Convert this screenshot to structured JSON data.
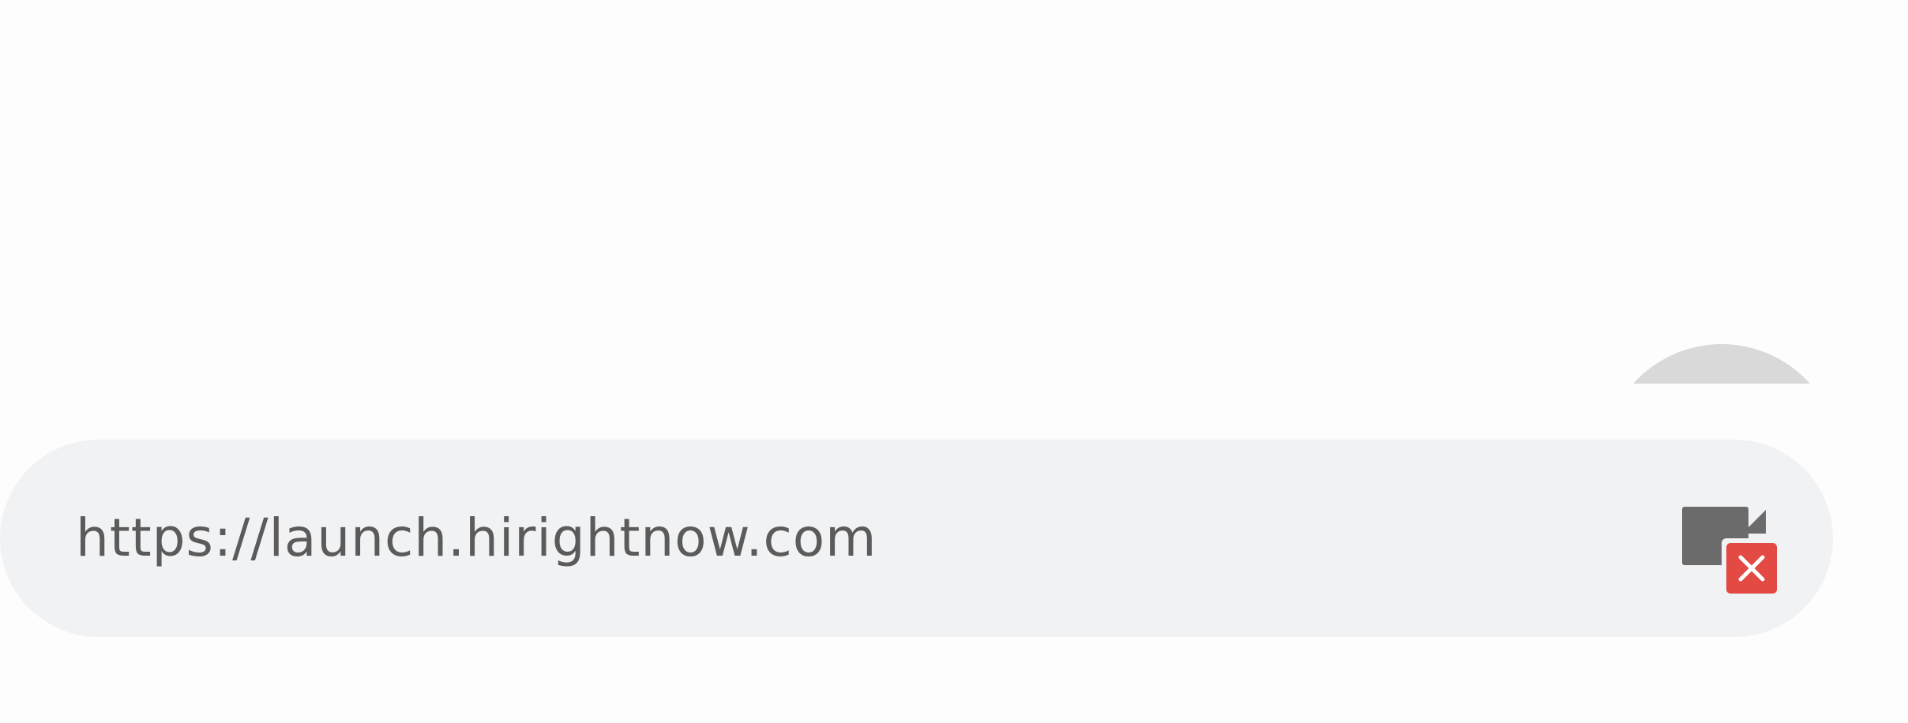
{
  "url_bar": {
    "url": "https://launch.hirightnow.com"
  },
  "icons": {
    "end_video": "camera-off-icon",
    "close": "close-icon"
  },
  "colors": {
    "bar_background": "#f1f2f4",
    "text": "#5b5b5b",
    "camera_icon": "#6b6b6b",
    "close_badge": "#e24a43",
    "cap": "#d9d9d9"
  }
}
